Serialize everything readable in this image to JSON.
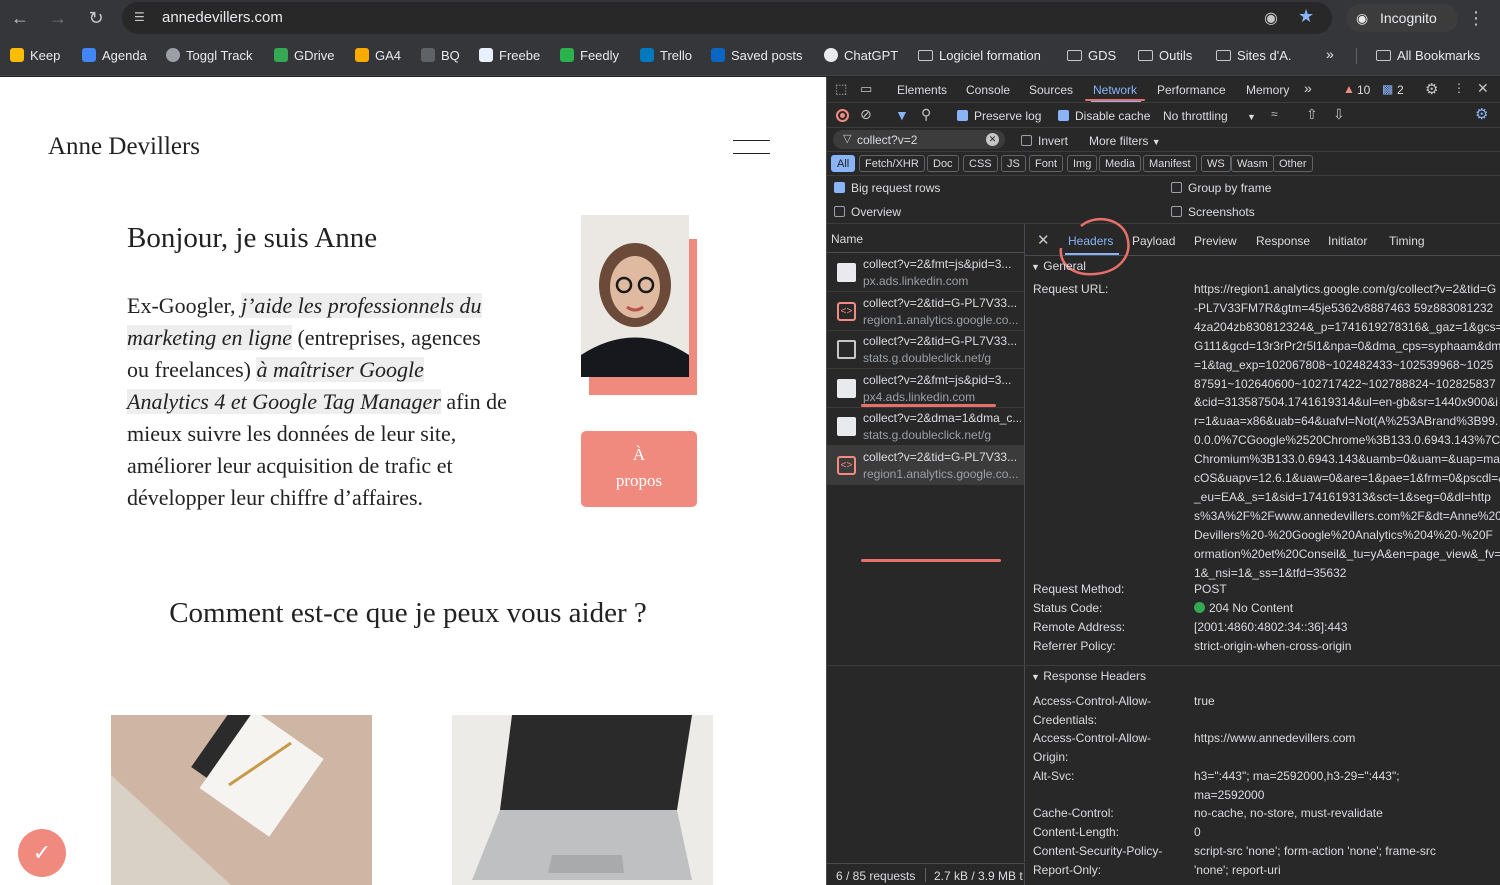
{
  "browser": {
    "url": "annedevillers.com",
    "incognito": "Incognito"
  },
  "bookmarks": {
    "keep": "Keep",
    "agenda": "Agenda",
    "toggl": "Toggl Track",
    "gdrive": "GDrive",
    "ga4": "GA4",
    "bq": "BQ",
    "freebe": "Freebe",
    "feedly": "Feedly",
    "trello": "Trello",
    "saved": "Saved posts",
    "chatgpt": "ChatGPT",
    "logiciel": "Logiciel formation",
    "gds": "GDS",
    "outils": "Outils",
    "sites": "Sites d'A.",
    "all": "All Bookmarks"
  },
  "page": {
    "logo": "Anne Devillers",
    "heading": "Bonjour, je suis Anne",
    "intro_1": "Ex-Googler, ",
    "intro_2": "j’aide les professionnels du marketing en ligne",
    "intro_3": " (entreprises, agences ou freelances) ",
    "intro_4": "à maîtriser Google Analytics 4 et Google Tag Manager",
    "intro_5": " afin de mieux suivre les données de leur site, améliorer leur acquisition de trafic et développer leur chiffre d’affaires.",
    "about_l1": "À",
    "about_l2": "propos",
    "help_heading": "Comment est-ce que je peux vous aider ?"
  },
  "devtools": {
    "tabs": {
      "elements": "Elements",
      "console": "Console",
      "sources": "Sources",
      "network": "Network",
      "performance": "Performance",
      "memory": "Memory",
      "warnings": "10",
      "messages": "2"
    },
    "toolbar": {
      "preserve": "Preserve log",
      "disable_cache": "Disable cache",
      "throttling": "No throttling"
    },
    "filter": {
      "value": "collect?v=2",
      "invert": "Invert",
      "more": "More filters"
    },
    "types": [
      "All",
      "Fetch/XHR",
      "Doc",
      "CSS",
      "JS",
      "Font",
      "Img",
      "Media",
      "Manifest",
      "WS",
      "Wasm",
      "Other"
    ],
    "options": {
      "big": "Big request rows",
      "group": "Group by frame",
      "overview": "Overview",
      "screenshots": "Screenshots"
    },
    "name_header": "Name",
    "requests": [
      {
        "name": "collect?v=2&fmt=js&pid=3...",
        "host": "px.ads.linkedin.com",
        "icon": "image"
      },
      {
        "name": "collect?v=2&tid=G-PL7V33...",
        "host": "region1.analytics.google.co...",
        "icon": "script"
      },
      {
        "name": "collect?v=2&tid=G-PL7V33...",
        "host": "stats.g.doubleclick.net/g",
        "icon": "blank"
      },
      {
        "name": "collect?v=2&fmt=js&pid=3...",
        "host": "px4.ads.linkedin.com",
        "icon": "image"
      },
      {
        "name": "collect?v=2&dma=1&dma_c...",
        "host": "stats.g.doubleclick.net/g",
        "icon": "image"
      },
      {
        "name": "collect?v=2&tid=G-PL7V33...",
        "host": "region1.analytics.google.co...",
        "icon": "script"
      }
    ],
    "detail_tabs": {
      "headers": "Headers",
      "payload": "Payload",
      "preview": "Preview",
      "response": "Response",
      "initiator": "Initiator",
      "timing": "Timing"
    },
    "general": "General",
    "request_url_label": "Request URL:",
    "request_url_lines": [
      "https://region1.analytics.google.com/g/collect?v=2&tid=G",
      "-PL7V33FM7R&gtm=45je5362v8887463 59z883081232",
      "4za204zb830812324&_p=1741619278316&_gaz=1&gcs=",
      "G111&gcd=13r3rPr2r5l1&npa=0&dma_cps=syphaam&dma",
      "=1&tag_exp=102067808~102482433~102539968~1025",
      "87591~102640600~102717422~102788824~102825837",
      "&cid=313587504.1741619314&ul=en-gb&sr=1440x900&i",
      "r=1&uaa=x86&uab=64&uafvl=Not(A%253ABrand%3B99.",
      "0.0.0%7CGoogle%2520Chrome%3B133.0.6943.143%7C",
      "Chromium%3B133.0.6943.143&uamb=0&uam=&uap=ma",
      "cOS&uapv=12.6.1&uaw=0&are=1&pae=1&frm=0&pscdl=&",
      "_eu=EA&_s=1&sid=1741619313&sct=1&seg=0&dl=http",
      "s%3A%2F%2Fwww.annedevillers.com%2F&dt=Anne%20",
      "Devillers%20-%20Google%20Analytics%204%20-%20F",
      "ormation%20et%20Conseil&_tu=yA&en=page_view&_fv=",
      "1&_nsi=1&_ss=1&tfd=35632"
    ],
    "general_rows": [
      {
        "label": "Request Method:",
        "value": "POST"
      },
      {
        "label": "Status Code:",
        "value": "204 No Content"
      },
      {
        "label": "Remote Address:",
        "value": "[2001:4860:4802:34::36]:443"
      },
      {
        "label": "Referrer Policy:",
        "value": "strict-origin-when-cross-origin"
      }
    ],
    "response_headers": "Response Headers",
    "resp": {
      "acac_l1": "Access-Control-Allow-",
      "acac_l2": "Credentials:",
      "acac_v": "true",
      "acao_l1": "Access-Control-Allow-",
      "acao_l2": "Origin:",
      "acao_v": "https://www.annedevillers.com",
      "alt_l": "Alt-Svc:",
      "alt_v1": "h3=\":443\"; ma=2592000,h3-29=\":443\";",
      "alt_v2": "ma=2592000",
      "cc_l": "Cache-Control:",
      "cc_v": "no-cache, no-store, must-revalidate",
      "cl_l": "Content-Length:",
      "cl_v": "0",
      "csp_l1": "Content-Security-Policy-",
      "csp_l2": "Report-Only:",
      "csp_v1": "script-src 'none'; form-action 'none'; frame-src",
      "csp_v2": "'none'; report-uri"
    },
    "footer": {
      "requests": "6 / 85 requests",
      "transfer": "2.7 kB / 3.9 MB t"
    },
    "colors": {
      "accent": "#8ab4f8",
      "annotation": "#e8706a",
      "status_ok": "#34a853"
    }
  }
}
